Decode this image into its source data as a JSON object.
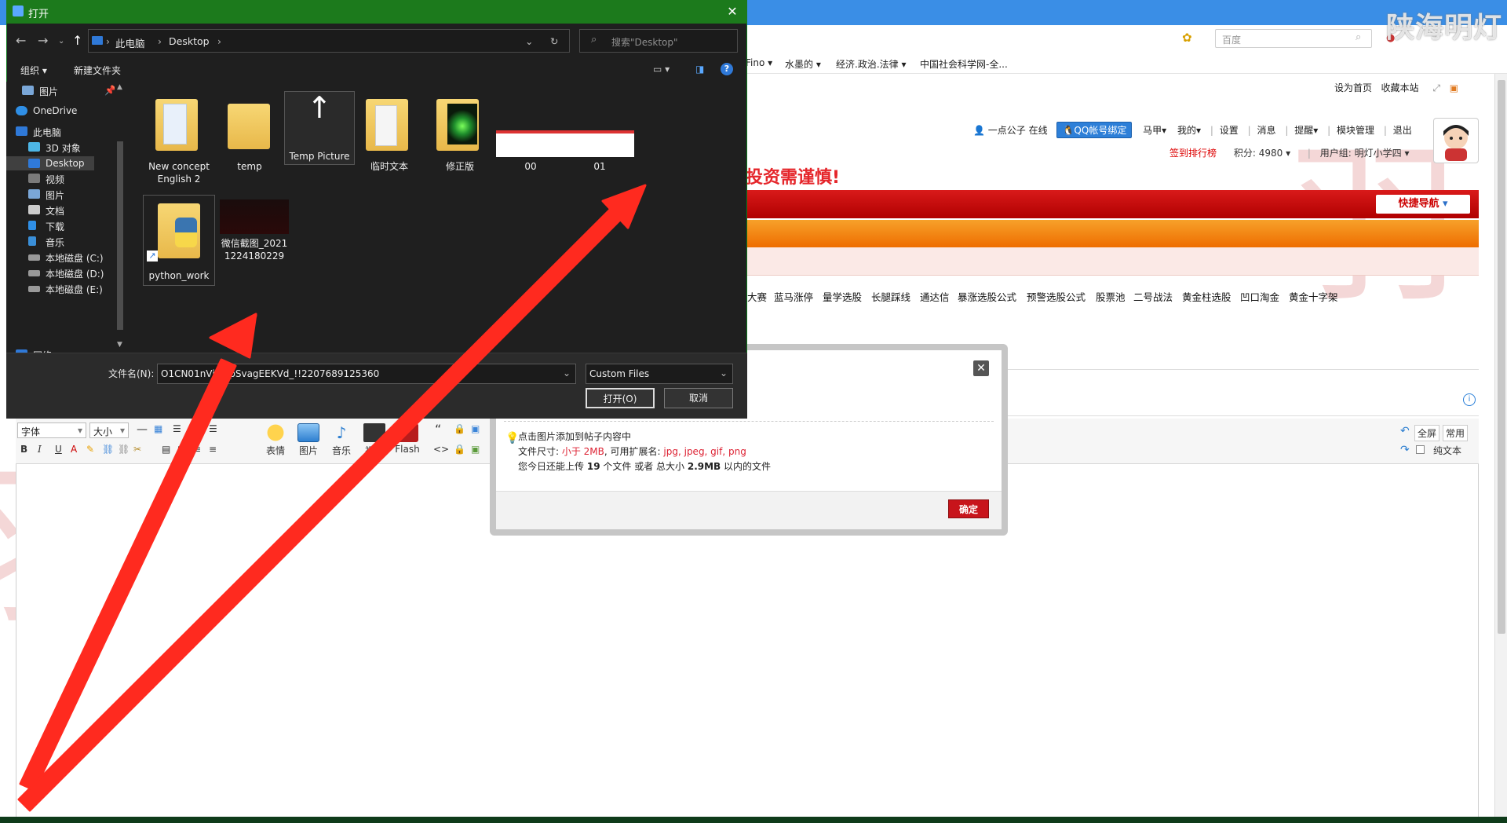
{
  "browser": {
    "search_placeholder": "百度",
    "bookmarks": [
      "Fino",
      "水墨的",
      "经济.政治.法律",
      "中国社会科学网-全..."
    ]
  },
  "forum": {
    "toplinks": [
      "设为首页",
      "收藏本站"
    ],
    "user": {
      "name": "一点公子",
      "online": "在线",
      "qq_bind": "QQ帐号绑定",
      "menu": [
        "马甲",
        "我的",
        "设置",
        "消息",
        "提醒",
        "模块管理",
        "退出"
      ],
      "signin_rank": "签到排行榜",
      "points": "积分: 4980",
      "group": "用户组: 明灯小学四"
    },
    "headline": "投资需谨慎!",
    "quick_nav": "快捷导航",
    "links": [
      "大赛",
      "蓝马涨停",
      "量学选股",
      "长腿踩线",
      "通达信",
      "暴涨选股公式",
      "预警选股公式",
      "股票池",
      "二号战法",
      "黄金柱选股",
      "凹口淘金",
      "黄金十字架"
    ]
  },
  "editor": {
    "font_select": "字体",
    "size_select": "大小",
    "tools": [
      "表情",
      "图片",
      "音乐",
      "视频",
      "Flash"
    ],
    "fullscreen": "全屏",
    "common": "常用",
    "plain_text": "纯文本"
  },
  "upload": {
    "tip_line1": "点击图片添加到帖子内容中",
    "size_label": "文件尺寸: ",
    "size_value": "小于 2MB",
    "ext_label": ", 可用扩展名: ",
    "ext_value": "jpg, jpeg, gif, png",
    "quota_prefix": "您今日还能上传",
    "quota_count": "19",
    "quota_mid": "个文件 或者 总大小",
    "quota_size": "2.9MB",
    "quota_suffix": "以内的文件",
    "confirm": "确定"
  },
  "file_dialog": {
    "title": "打开",
    "breadcrumb": [
      "此电脑",
      "Desktop"
    ],
    "search_placeholder": "搜索\"Desktop\"",
    "organize": "组织 ▾",
    "new_folder": "新建文件夹",
    "nav_items": [
      "图片",
      "OneDrive",
      "此电脑",
      "3D 对象",
      "Desktop",
      "视频",
      "图片",
      "文档",
      "下载",
      "音乐",
      "本地磁盘 (C:)",
      "本地磁盘 (D:)",
      "本地磁盘 (E:)",
      "网络"
    ],
    "files": [
      "New concept English 2",
      "temp",
      "Temp Picture",
      "临时文本",
      "修正版",
      "00",
      "01",
      "python_work",
      "微信截图_20211224180229"
    ],
    "filename_label": "文件名(N):",
    "filename_value": "O1CN01nVjk...pSvagEEKVd_!!2207689125360",
    "filetype_value": "Custom Files",
    "open_button": "打开(O)",
    "cancel_button": "取消"
  },
  "watermark": "陕海明灯",
  "colors": {
    "dialog_titlebar": "#1c7a1c",
    "arrow": "#ff2a1f",
    "forum_red": "#c8141b",
    "forum_orange": "#f39a1c"
  }
}
